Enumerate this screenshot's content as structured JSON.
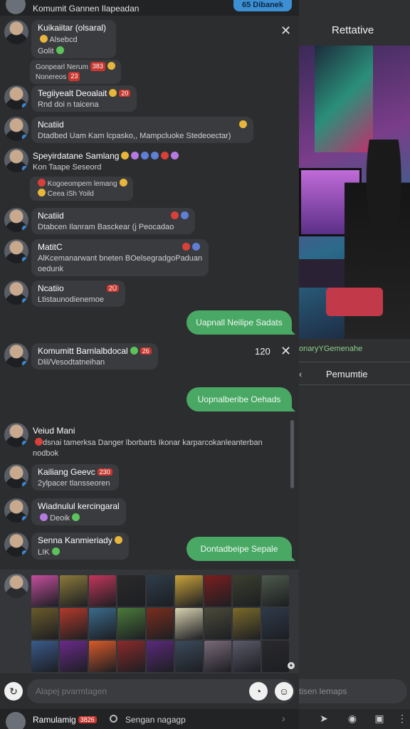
{
  "header": {
    "title": "Komumit Gannen Ilapeadan",
    "pill_label": "65 Dibanek"
  },
  "messages": [
    {
      "sender": "Kuikaiitar (olsaral)",
      "line1": "Alsebcd",
      "line2": "Golit"
    },
    {
      "sub_line1": "Gonpearl Nerum",
      "sub_tag": "383",
      "sub_line2": "Nonereos",
      "sub_tag2": "23"
    },
    {
      "sender": "Tegiiyealt Deoalait",
      "tag": "20",
      "text": "Rnd doi n taicena"
    },
    {
      "sender": "Ncatiid",
      "text": "Dtadbed Uam Kam lcpasko,, Mampcluoke Stedeoectar)"
    },
    {
      "sender": "Speyirdatane Samlang",
      "text": "Kon Taape Seseord",
      "sub_line1": "Kogoeompem lemang",
      "sub_line2": "Ceea iSh Yoild"
    },
    {
      "sender": "Ncatiid",
      "text": "Dtabcen Ilanram Basckear (j Peocadao"
    },
    {
      "sender": "MatitC",
      "text": "AlKcemanarwant bneten BOelsegradgoPaduan",
      "text2": "oedunk"
    },
    {
      "sender": "Ncatiio",
      "tag": "2Ū",
      "text": "Ltistaunodienemoe"
    },
    {
      "outgoing": "Uapnall Neilipe Sadats"
    },
    {
      "sender": "Komumitt Barnlalbdocal",
      "tag": "26",
      "text": "Dlil/Vesodtatneihan",
      "counter": "120"
    },
    {
      "outgoing": "Uopnalberibe Oehads"
    },
    {
      "sender": "Veiud Mani",
      "text": "dsnai tamerksa Danger lborbarts Ikonar karparcokanleanterban",
      "text2": "nodbok"
    },
    {
      "sender": "Kailiang Geevc",
      "tag": "230",
      "text": "2ylpacer tlansseoren"
    },
    {
      "sender": "Wiadnulul kercingaral",
      "text": "Deoik"
    },
    {
      "sender": "Senna Kanmieriady",
      "text": "LIK"
    },
    {
      "outgoing": "Dontadbeipe Sepale"
    }
  ],
  "composer": {
    "placeholder": "Alapej pvarmtagen"
  },
  "bottom_bar": {
    "name": "Ramulamig",
    "tag": "3826",
    "search_text": "Sengan nagagp"
  },
  "right_pane": {
    "title": "Rettative",
    "caption": "onaryYGemenahe",
    "action_label": "Pemumtie",
    "input_placeholder": "tisen lemaps"
  },
  "thumbnail_colors": [
    "#c44f9d",
    "#8a7a3a",
    "#c2365a",
    "#2a2a2a",
    "#2e3d4a",
    "#c8a23a",
    "#7a1e1e",
    "#3b3f2e",
    "#4d5a4a",
    "#6a5a2a",
    "#b23a2a",
    "#3a6a8a",
    "#4a7a3a",
    "#7a2e1e",
    "#d8d2b0",
    "#4a4a3a",
    "#7a6a2a",
    "#2e3a4a",
    "#3a5a8a",
    "#6a2a8a",
    "#d85a2a",
    "#8a2a2a",
    "#5a2a7a",
    "#3a4a5a",
    "#7a6a7a",
    "#5a5a6a",
    "#2a2a2e"
  ]
}
